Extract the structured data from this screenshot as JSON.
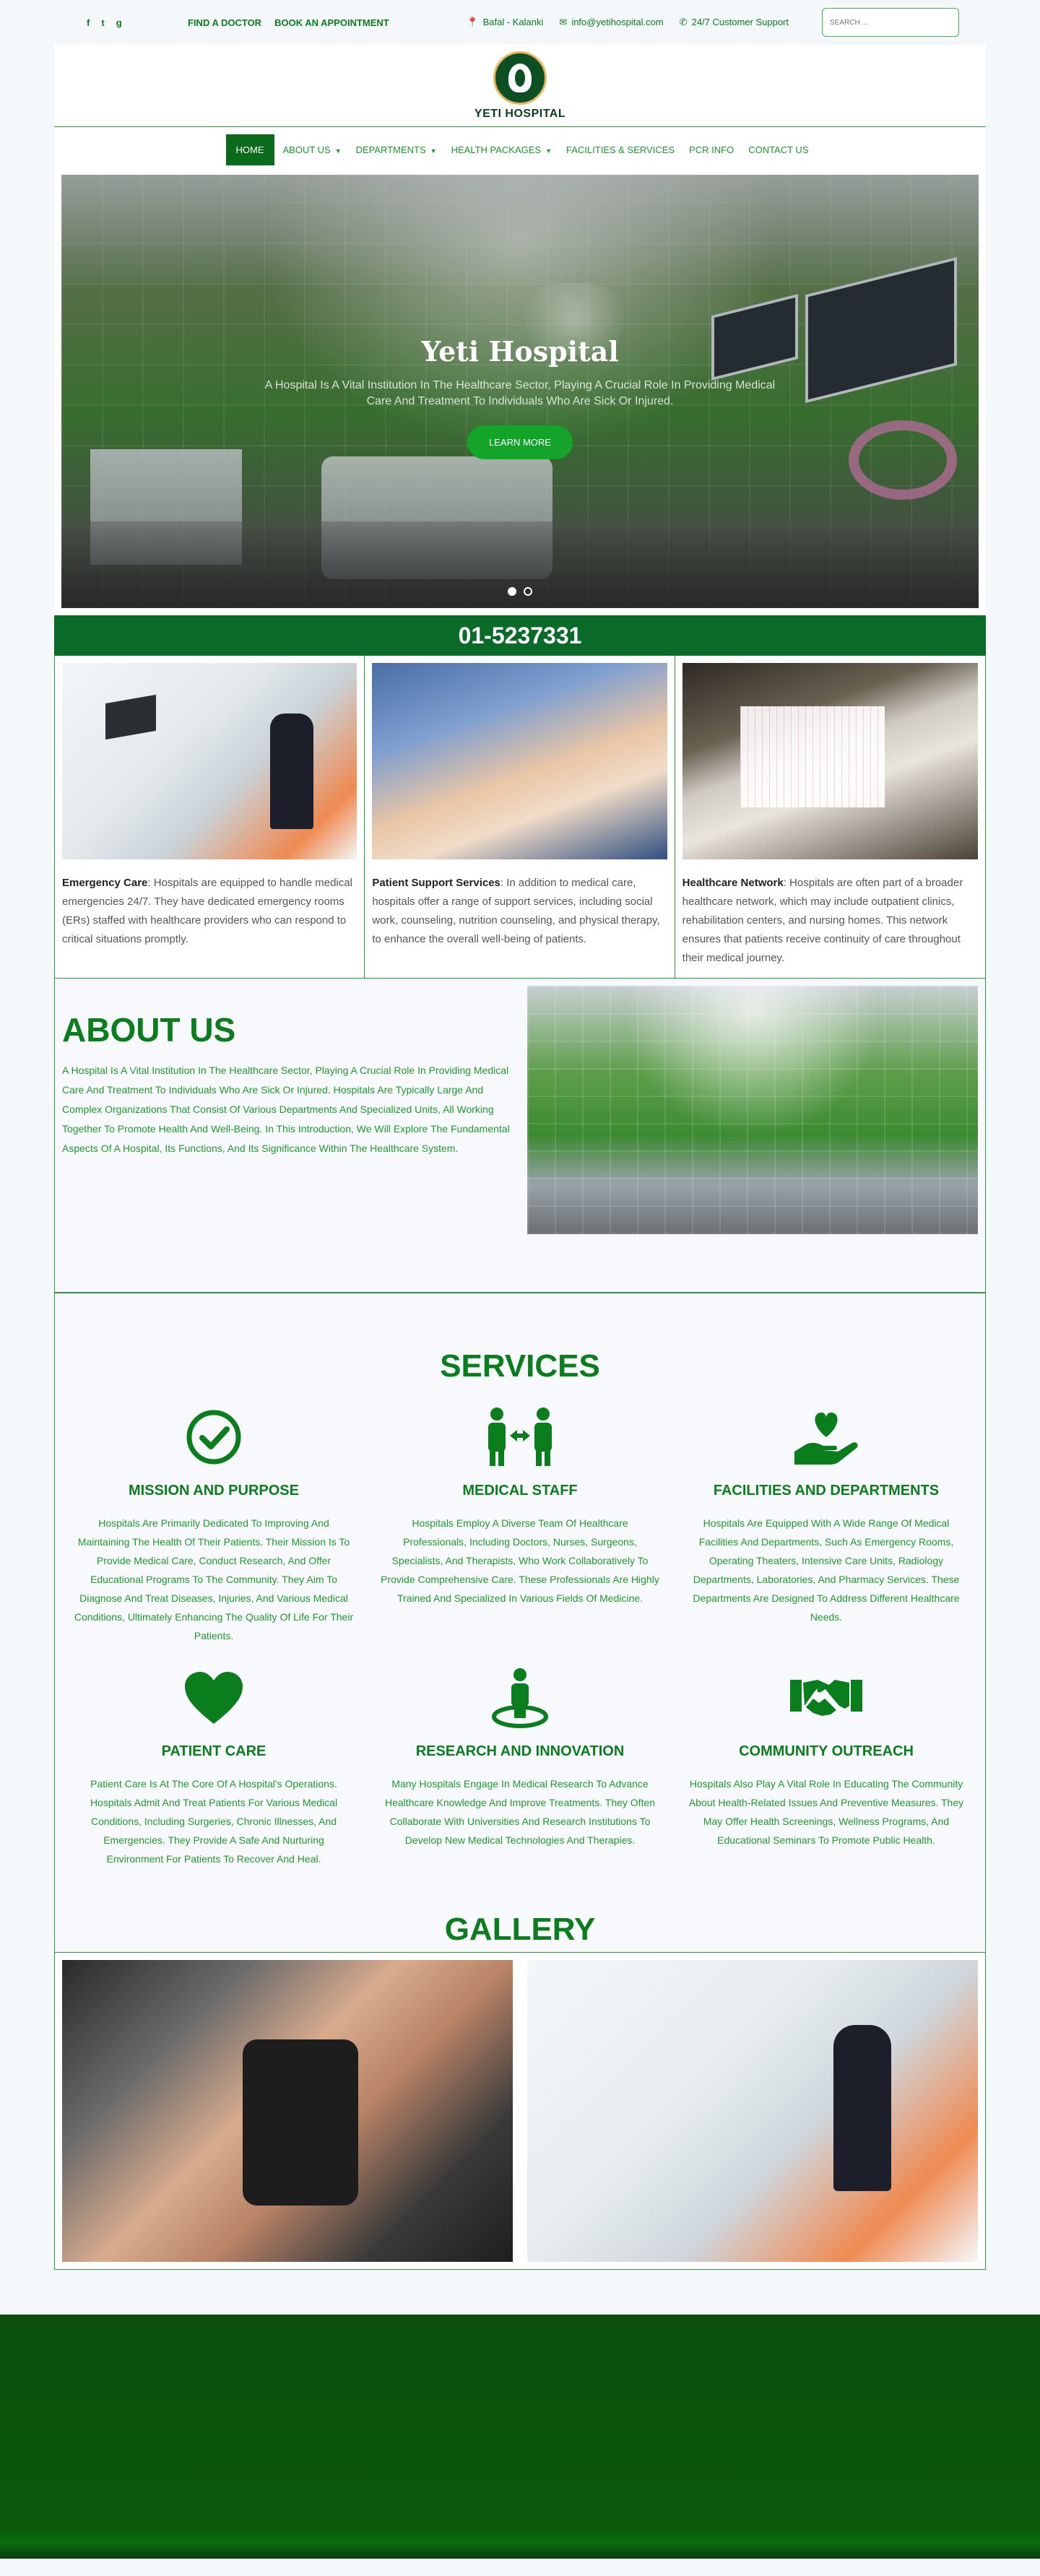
{
  "topbar": {
    "social": [
      "f",
      "t",
      "g"
    ],
    "links": [
      "FIND A DOCTOR",
      "BOOK AN APPOINTMENT"
    ],
    "address": "Bafal - Kalanki",
    "email": "info@yetihospital.com",
    "support": "24/7 Customer Support",
    "search_placeholder": "SEARCH ..."
  },
  "brand": {
    "name": "YETI HOSPITAL"
  },
  "nav": [
    {
      "label": "HOME",
      "dropdown": false
    },
    {
      "label": "ABOUT US",
      "dropdown": true
    },
    {
      "label": "DEPARTMENTS",
      "dropdown": true
    },
    {
      "label": "HEALTH PACKAGES",
      "dropdown": true
    },
    {
      "label": "FACILITIES & SERVICES",
      "dropdown": false
    },
    {
      "label": "PCR INFO",
      "dropdown": false
    },
    {
      "label": "CONTACT US",
      "dropdown": false
    }
  ],
  "hero": {
    "title": "Yeti Hospital",
    "text": "A Hospital Is A Vital Institution In The Healthcare Sector, Playing A Crucial Role In Providing Medical Care And Treatment To Individuals Who Are Sick Or Injured.",
    "button": "LEARN MORE"
  },
  "phone": "01-5237331",
  "features": [
    {
      "heading": "Emergency Care",
      "text": ": Hospitals are equipped to handle medical emergencies 24/7. They have dedicated emergency rooms (ERs) staffed with healthcare providers who can respond to critical situations promptly."
    },
    {
      "heading": "Patient Support Services",
      "text": ": In addition to medical care, hospitals offer a range of support services, including social work, counseling, nutrition counseling, and physical therapy, to enhance the overall well-being of patients."
    },
    {
      "heading": "Healthcare Network",
      "text": ": Hospitals are often part of a broader healthcare network, which may include outpatient clinics, rehabilitation centers, and nursing homes. This network ensures that patients receive continuity of care throughout their medical journey."
    }
  ],
  "about": {
    "title": "ABOUT US",
    "text": "A Hospital Is A Vital Institution In The Healthcare Sector, Playing A Crucial Role In Providing Medical Care And Treatment To Individuals Who Are Sick Or Injured. Hospitals Are Typically Large And Complex Organizations That Consist Of Various Departments And Specialized Units, All Working Together To Promote Health And Well-Being. In This Introduction, We Will Explore The Fundamental Aspects Of A Hospital, Its Functions, And Its Significance Within The Healthcare System."
  },
  "services": {
    "title": "SERVICES",
    "items": [
      {
        "icon": "check-circle-icon",
        "title": "MISSION AND PURPOSE",
        "text": "Hospitals Are Primarily Dedicated To Improving And Maintaining The Health Of Their Patients. Their Mission Is To Provide Medical Care, Conduct Research, And Offer Educational Programs To The Community. They Aim To Diagnose And Treat Diseases, Injuries, And Various Medical Conditions, Ultimately Enhancing The Quality Of Life For Their Patients."
      },
      {
        "icon": "people-arrows-icon",
        "title": "MEDICAL STAFF",
        "text": "Hospitals Employ A Diverse Team Of Healthcare Professionals, Including Doctors, Nurses, Surgeons, Specialists, And Therapists, Who Work Collaboratively To Provide Comprehensive Care. These Professionals Are Highly Trained And Specialized In Various Fields Of Medicine."
      },
      {
        "icon": "hand-holding-heart-icon",
        "title": "FACILITIES AND DEPARTMENTS",
        "text": "Hospitals Are Equipped With A Wide Range Of Medical Facilities And Departments, Such As Emergency Rooms, Operating Theaters, Intensive Care Units, Radiology Departments, Laboratories, And Pharmacy Services. These Departments Are Designed To Address Different Healthcare Needs."
      },
      {
        "icon": "heart-icon",
        "title": "PATIENT CARE",
        "text": "Patient Care Is At The Core Of A Hospital's Operations. Hospitals Admit And Treat Patients For Various Medical Conditions, Including Surgeries, Chronic Illnesses, And Emergencies. They Provide A Safe And Nurturing Environment For Patients To Recover And Heal."
      },
      {
        "icon": "person-circle-icon",
        "title": "RESEARCH AND INNOVATION",
        "text": "Many Hospitals Engage In Medical Research To Advance Healthcare Knowledge And Improve Treatments. They Often Collaborate With Universities And Research Institutions To Develop New Medical Technologies And Therapies."
      },
      {
        "icon": "handshake-icon",
        "title": "COMMUNITY OUTREACH",
        "text": "Hospitals Also Play A Vital Role In Educating The Community About Health-Related Issues And Preventive Measures. They May Offer Health Screenings, Wellness Programs, And Educational Seminars To Promote Public Health."
      }
    ]
  },
  "gallery": {
    "title": "GALLERY"
  },
  "colors": {
    "primary": "#0a7d1c",
    "dark": "#0a6b28",
    "footer": "#0a4f0c"
  }
}
